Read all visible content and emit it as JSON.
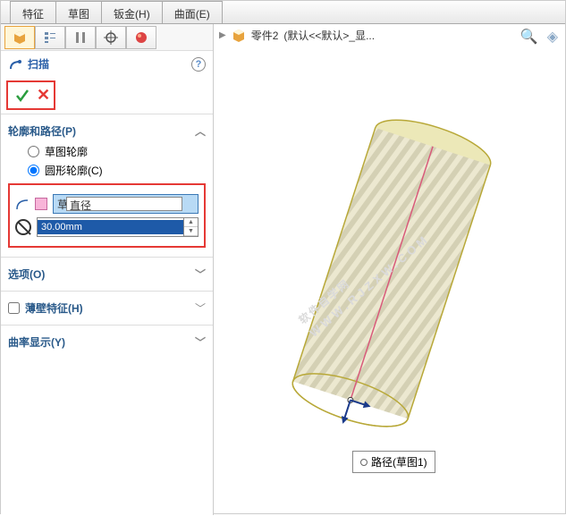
{
  "top_tabs": {
    "t0": "特征",
    "t1": "草图",
    "t2": "钣金(H)",
    "t3": "曲面(E)"
  },
  "crumb": {
    "part": "零件2",
    "config": "(默认<<默认>_显..."
  },
  "feature": {
    "name": "扫描"
  },
  "sect1": {
    "title": "轮廓和路径(P)",
    "r1": "草图轮廓",
    "r2": "圆形轮廓(C)",
    "sel_prefix": "草",
    "sel_inner": "直径",
    "diameter": "30.00mm"
  },
  "sect2": {
    "title": "选项(O)"
  },
  "sect3": {
    "label": "薄壁特征(H)"
  },
  "sect4": {
    "title": "曲率显示(Y)"
  },
  "callout": {
    "label": "路径(草图1)"
  },
  "watermark": {
    "l1": "软件自学网",
    "l2": "WWW.RJZXW.COM"
  }
}
